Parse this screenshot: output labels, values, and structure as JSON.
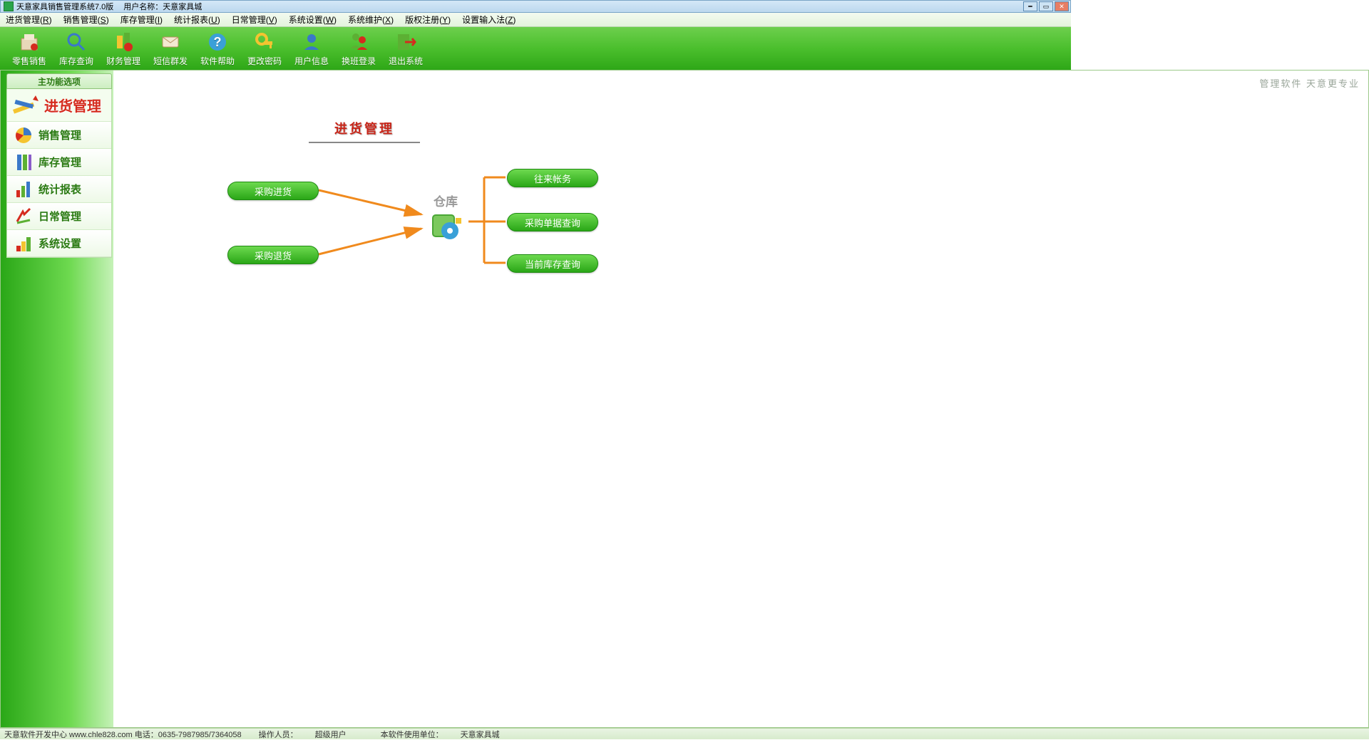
{
  "title": {
    "app": "天意家具销售管理系统7.0版",
    "user_prefix": "用户名称：",
    "user": "天意家具城"
  },
  "menubar": [
    {
      "label": "进货管理",
      "key": "R"
    },
    {
      "label": "销售管理",
      "key": "S"
    },
    {
      "label": "库存管理",
      "key": "I"
    },
    {
      "label": "统计报表",
      "key": "U"
    },
    {
      "label": "日常管理",
      "key": "V"
    },
    {
      "label": "系统设置",
      "key": "W"
    },
    {
      "label": "系统维护",
      "key": "X"
    },
    {
      "label": "版权注册",
      "key": "Y"
    },
    {
      "label": "设置输入法",
      "key": "Z"
    }
  ],
  "toolbar": [
    {
      "id": "retail",
      "label": "零售销售"
    },
    {
      "id": "stock-query",
      "label": "库存查询"
    },
    {
      "id": "finance",
      "label": "财务管理"
    },
    {
      "id": "sms",
      "label": "短信群发"
    },
    {
      "id": "help",
      "label": "软件帮助"
    },
    {
      "id": "password",
      "label": "更改密码"
    },
    {
      "id": "user-info",
      "label": "用户信息"
    },
    {
      "id": "shift",
      "label": "换班登录"
    },
    {
      "id": "exit",
      "label": "退出系统"
    }
  ],
  "sidebar": {
    "tab": "主功能选项",
    "active": {
      "id": "purchase",
      "label": "进货管理"
    },
    "items": [
      {
        "id": "sales",
        "label": "销售管理"
      },
      {
        "id": "inventory",
        "label": "库存管理"
      },
      {
        "id": "report",
        "label": "统计报表"
      },
      {
        "id": "daily",
        "label": "日常管理"
      },
      {
        "id": "settings",
        "label": "系统设置"
      }
    ]
  },
  "content": {
    "brand": "管理软件 天意更专业",
    "flow_title": "进货管理",
    "warehouse": "仓库",
    "nodes": {
      "in": "采购进货",
      "return": "采购退货",
      "acct": "往来帐务",
      "query": "采购单据查询",
      "stock": "当前库存查询"
    }
  },
  "status": {
    "company": "天意软件开发中心 www.chle828.com 电话：0635-7987985/7364058",
    "operator_prefix": "操作人员：",
    "operator": "超级用户",
    "unit_prefix": "本软件使用单位：",
    "unit": "天意家具城"
  }
}
